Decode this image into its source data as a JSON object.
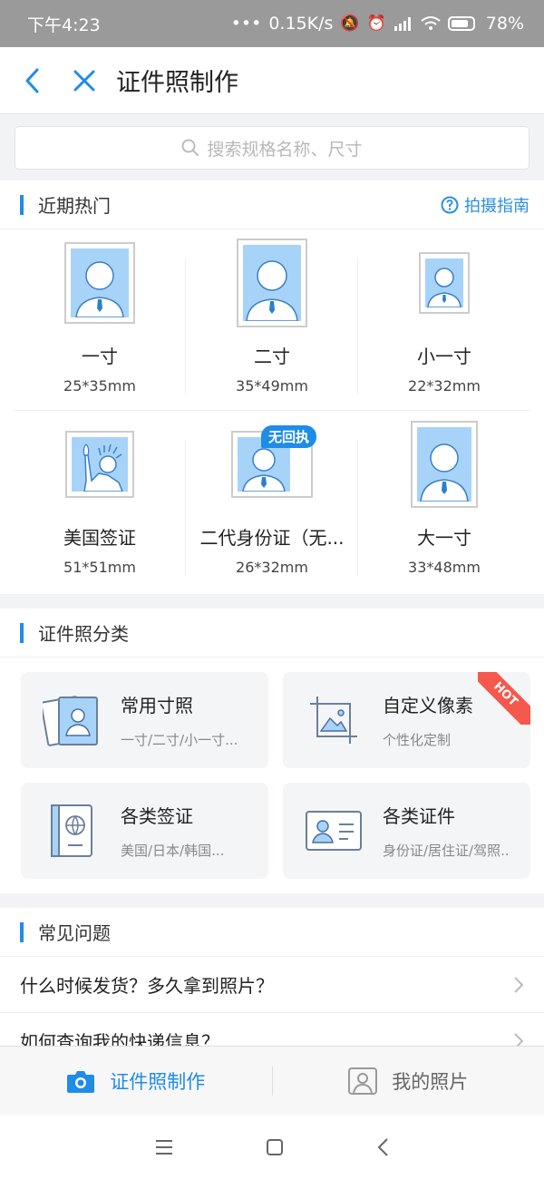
{
  "status": {
    "time": "下午4:23",
    "dots": "•••",
    "network_speed": "0.15K/s",
    "battery_pct": "78%"
  },
  "nav": {
    "title": "证件照制作",
    "back_icon": "chevron-left-icon",
    "close_icon": "close-icon"
  },
  "search": {
    "placeholder": "搜索规格名称、尺寸"
  },
  "hot": {
    "title": "近期热门",
    "guide_label": "拍摄指南",
    "items": [
      {
        "name": "一寸",
        "size": "25*35mm"
      },
      {
        "name": "二寸",
        "size": "35*49mm"
      },
      {
        "name": "小一寸",
        "size": "22*32mm"
      },
      {
        "name": "美国签证",
        "size": "51*51mm"
      },
      {
        "name": "二代身份证（无...",
        "size": "26*32mm",
        "badge": "无回执"
      },
      {
        "name": "大一寸",
        "size": "33*48mm"
      }
    ]
  },
  "categories": {
    "title": "证件照分类",
    "items": [
      {
        "title": "常用寸照",
        "sub": "一寸/二寸/小一寸..."
      },
      {
        "title": "自定义像素",
        "sub": "个性化定制",
        "ribbon": "HOT"
      },
      {
        "title": "各类签证",
        "sub": "美国/日本/韩国..."
      },
      {
        "title": "各类证件",
        "sub": "身份证/居住证/驾照.."
      }
    ]
  },
  "faq": {
    "title": "常见问题",
    "items": [
      "什么时候发货？多久拿到照片？",
      "如何查询我的快递信息？"
    ]
  },
  "tabs": {
    "make": "证件照制作",
    "mine": "我的照片"
  },
  "colors": {
    "accent": "#1f8ce8",
    "photo_bg": "#a7d3f8",
    "hot_ribbon": "#f5584c"
  }
}
